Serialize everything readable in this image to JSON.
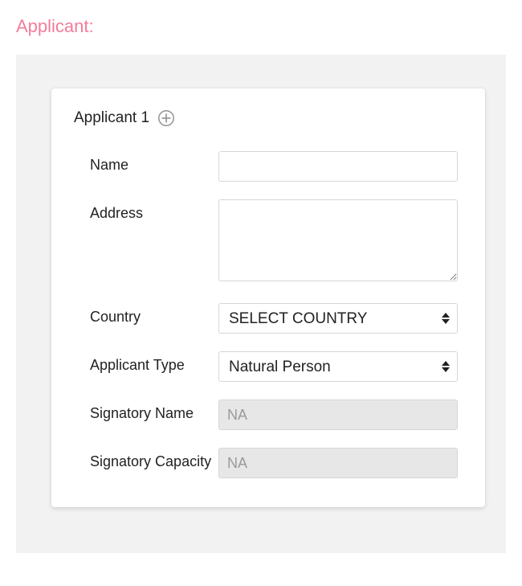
{
  "section": {
    "title": "Applicant:"
  },
  "card": {
    "title": "Applicant 1"
  },
  "fields": {
    "name": {
      "label": "Name",
      "value": ""
    },
    "address": {
      "label": "Address",
      "value": ""
    },
    "country": {
      "label": "Country",
      "selected": "SELECT COUNTRY"
    },
    "applicant_type": {
      "label": "Applicant Type",
      "selected": "Natural Person"
    },
    "signatory_name": {
      "label": "Signatory Name",
      "value": "NA"
    },
    "signatory_capacity": {
      "label": "Signatory Capacity",
      "value": "NA"
    }
  }
}
